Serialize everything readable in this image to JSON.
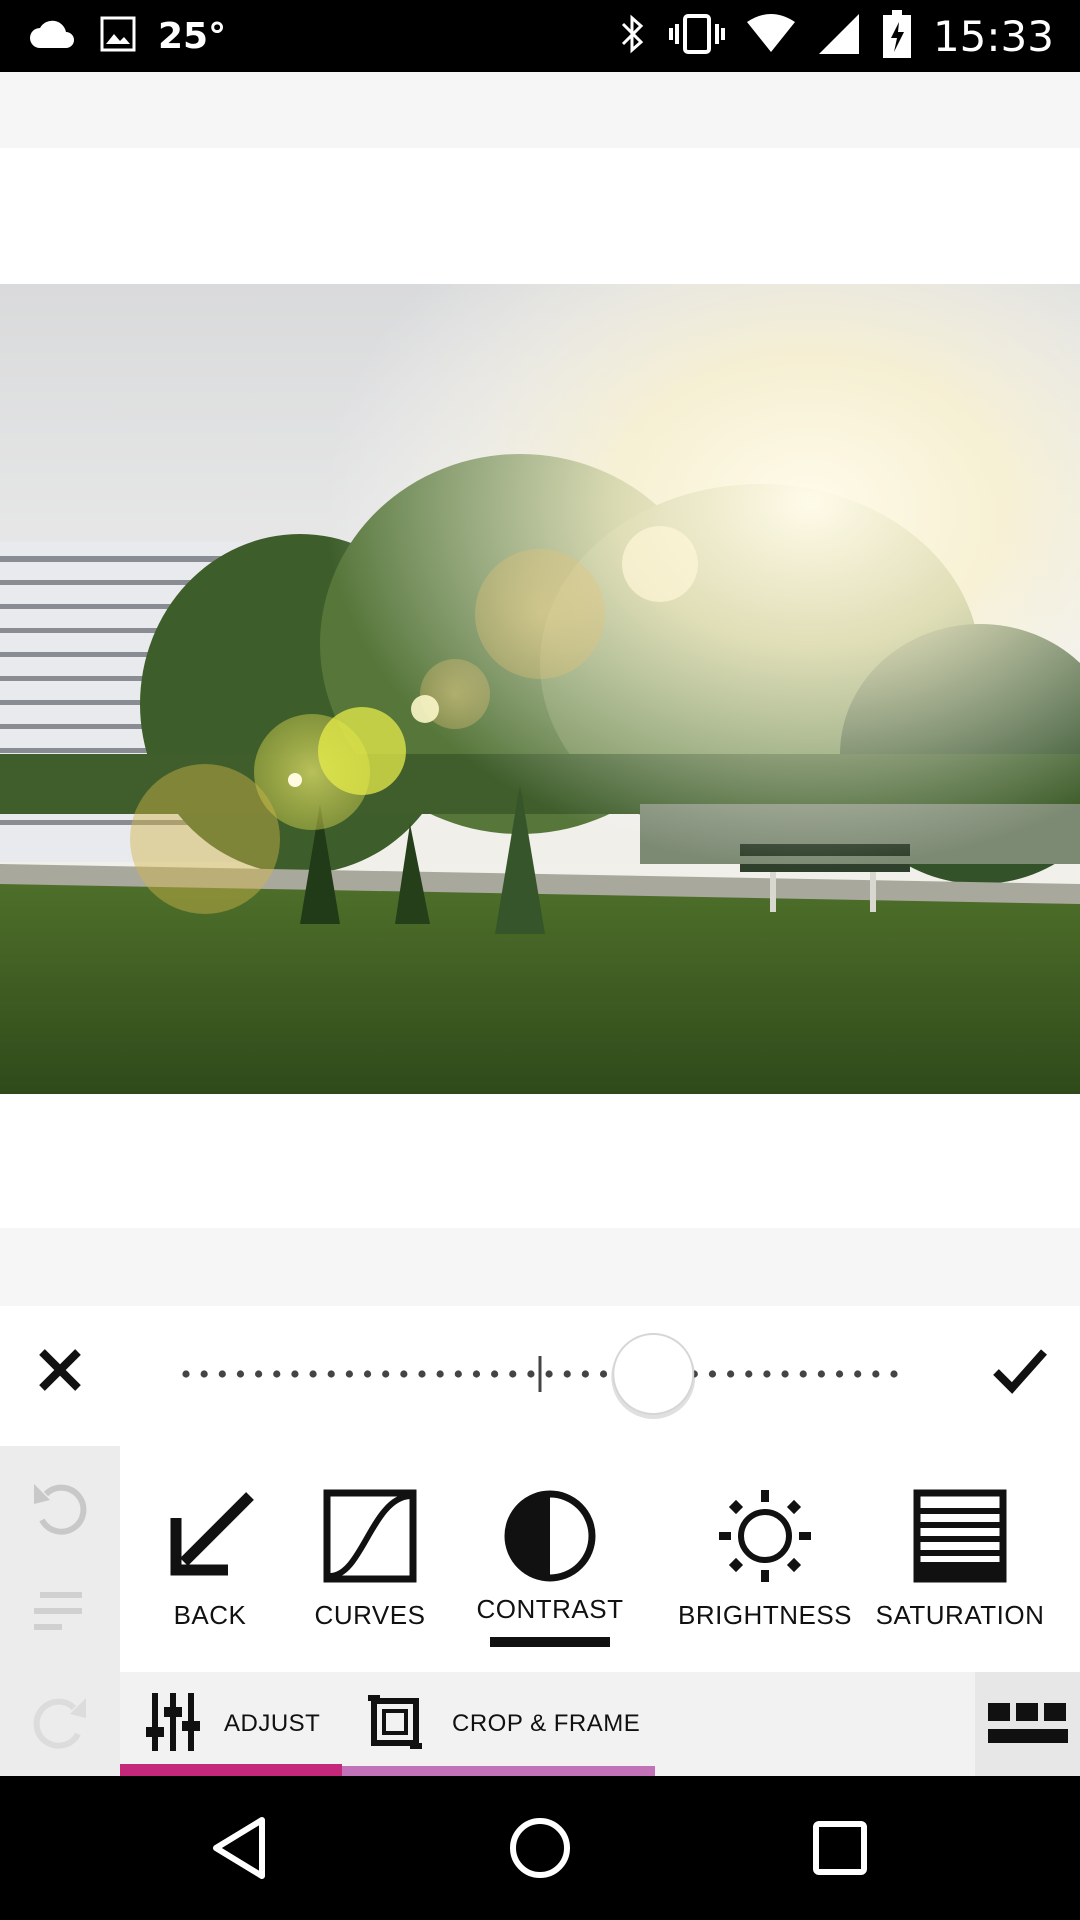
{
  "status_bar": {
    "temperature": "25°",
    "time": "15:33",
    "icons": [
      "cloud-icon",
      "image-icon",
      "bluetooth-icon",
      "vibrate-icon",
      "wifi-icon",
      "signal-icon",
      "battery-charging-icon"
    ]
  },
  "slider": {
    "value_fraction": 0.66,
    "center_mark": 0.5,
    "cancel_icon": "close-icon",
    "apply_icon": "check-icon"
  },
  "history": {
    "undo_icon": "undo-icon",
    "list_icon": "history-list-icon",
    "redo_icon": "redo-icon"
  },
  "tools": [
    {
      "label": "BACK",
      "icon": "back-arrow-icon"
    },
    {
      "label": "CURVES",
      "icon": "curves-icon"
    },
    {
      "label": "CONTRAST",
      "icon": "contrast-icon",
      "active": true
    },
    {
      "label": "BRIGHTNESS",
      "icon": "brightness-icon"
    },
    {
      "label": "SATURATION",
      "icon": "saturation-icon"
    }
  ],
  "categories": [
    {
      "label": "ADJUST",
      "icon": "sliders-icon",
      "active": true
    },
    {
      "label": "CROP & FRAME",
      "icon": "crop-frame-icon"
    }
  ],
  "colors": {
    "accent_active": "#c4287a",
    "accent_inactive": "#c272b6"
  },
  "nav": {
    "back_icon": "nav-back-icon",
    "home_icon": "nav-home-icon",
    "recents_icon": "nav-recents-icon"
  }
}
